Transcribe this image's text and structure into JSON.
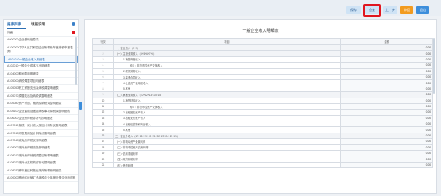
{
  "toolbar": {
    "btn1": "保存",
    "btn2": "检查",
    "btn3": "上一步",
    "btn4": "申报",
    "btn5": "退出"
  },
  "colors": {
    "highlight": "#e0161f",
    "accent_blue": "#3d8edb",
    "accent_orange": "#f29b1f"
  },
  "sidebar": {
    "tab_active": "报表列表",
    "tab_other": "填报说明",
    "gear_icon": "gear-icon",
    "items": [
      "封面",
      "A000000企业基础信息表",
      "A100000中华人民共和国企业所得税年度纳税申报表（A类）",
      "A101010一般企业收入明细表",
      "A102010一般企业成本支出明细表",
      "A104000期间费用明细表",
      "A105000纳税调整项目明细表",
      "A105050职工薪酬支出及纳税调整明细表",
      "A105070捐赠支出及纳税调整明细表",
      "A105080资产折旧、摊销及纳税调整明细表",
      "A105100企业重组及递延纳税事项纳税调整明细表",
      "A106000企业所得税弥补亏损明细表",
      "A107010免税、减计收入及加计扣除优惠明细表",
      "A107012研发费用加计扣除优惠明细表",
      "A107040减免所得税优惠明细表",
      "A108000境外所得税收抵免明细表",
      "A108010境外所得纳税调整后所得明细表",
      "A108020境外分支机构弥补亏损明细表",
      "A108030跨年度结转抵免境外所得税明细表",
      "A109000跨地区经营汇总纳税企业年度分摊企业所得税"
    ]
  },
  "main": {
    "title": "一般企业收入明细表",
    "columns": [
      "行次",
      "项目",
      "金额"
    ],
    "rows": [
      {
        "idx": "1",
        "name": "一、营业收入（2+9）",
        "amount": "0.00"
      },
      {
        "idx": "2",
        "name": "（一）主营业务收入（3+5+6+7+8）",
        "amount": "0.00"
      },
      {
        "idx": "3",
        "name": "1.销售商品收入",
        "amount": "0.00"
      },
      {
        "idx": "4",
        "name": "其中：非货币性资产交换收入",
        "amount": "0.00"
      },
      {
        "idx": "5",
        "name": "2.提供劳务收入",
        "amount": "0.00"
      },
      {
        "idx": "6",
        "name": "3.建造合同收入",
        "amount": "0.00"
      },
      {
        "idx": "7",
        "name": "4.让渡资产使用权收入",
        "amount": "0.00"
      },
      {
        "idx": "8",
        "name": "5.其他",
        "amount": "0.00"
      },
      {
        "idx": "9",
        "name": "（二）其他业务收入（10+12+13+14+15）",
        "amount": "0.00"
      },
      {
        "idx": "10",
        "name": "1.销售材料收入",
        "amount": "0.00"
      },
      {
        "idx": "11",
        "name": "其中：非货币性资产交换收入",
        "amount": "0.00"
      },
      {
        "idx": "12",
        "name": "2.出租固定资产收入",
        "amount": "0.00"
      },
      {
        "idx": "13",
        "name": "3.出租无形资产收入",
        "amount": "0.00"
      },
      {
        "idx": "14",
        "name": "4.出租包装物和商品收入",
        "amount": "0.00"
      },
      {
        "idx": "15",
        "name": "5.其他",
        "amount": "0.00"
      },
      {
        "idx": "16",
        "name": "二、营业外收入（17+18+19+20+21+22+23+24+25+26）",
        "amount": "0.00"
      },
      {
        "idx": "17",
        "name": "（一）非流动资产处置利得",
        "amount": "0.00"
      },
      {
        "idx": "18",
        "name": "（二）非货币性资产交换利得",
        "amount": "0.00"
      },
      {
        "idx": "19",
        "name": "（三）债务重组利得",
        "amount": "0.00"
      },
      {
        "idx": "20",
        "name": "（四）政府补助利得",
        "amount": "0.00"
      },
      {
        "idx": "21",
        "name": "（五）盘盈利得",
        "amount": "0.00"
      }
    ]
  }
}
